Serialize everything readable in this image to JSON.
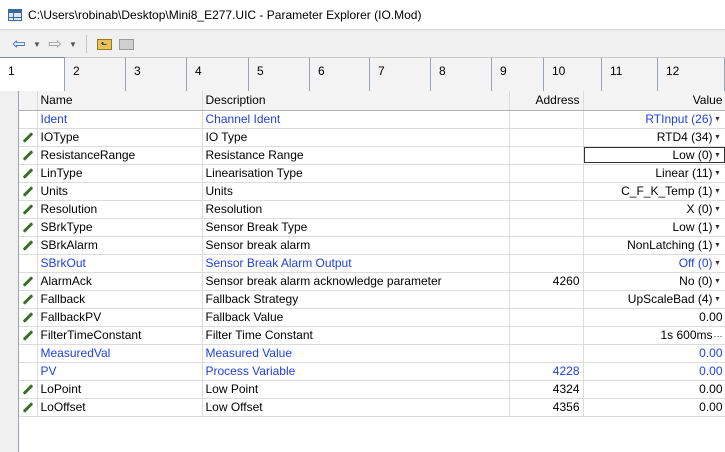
{
  "window": {
    "title": "C:\\Users\\robinab\\Desktop\\Mini8_E277.UIC - Parameter Explorer (IO.Mod)"
  },
  "toolbar": {
    "back_icon": "arrow-left-icon",
    "forward_icon": "arrow-right-icon"
  },
  "tabs": [
    "1",
    "2",
    "3",
    "4",
    "5",
    "6",
    "7",
    "8",
    "9",
    "10",
    "11",
    "12"
  ],
  "columns": {
    "name": "Name",
    "description": "Description",
    "address": "Address",
    "value": "Value"
  },
  "rows": [
    {
      "name": "Ident",
      "description": "Channel Ident",
      "address": "",
      "value": "RTInput (26)",
      "editable": false,
      "blue": true,
      "control": "dropdown"
    },
    {
      "name": "IOType",
      "description": "IO Type",
      "address": "",
      "value": "RTD4 (34)",
      "editable": true,
      "blue": false,
      "control": "dropdown"
    },
    {
      "name": "ResistanceRange",
      "description": "Resistance Range",
      "address": "",
      "value": "Low (0)",
      "editable": true,
      "blue": false,
      "control": "dropdown",
      "focused": true
    },
    {
      "name": "LinType",
      "description": "Linearisation Type",
      "address": "",
      "value": "Linear (11)",
      "editable": true,
      "blue": false,
      "control": "dropdown"
    },
    {
      "name": "Units",
      "description": "Units",
      "address": "",
      "value": "C_F_K_Temp (1)",
      "editable": true,
      "blue": false,
      "control": "dropdown"
    },
    {
      "name": "Resolution",
      "description": "Resolution",
      "address": "",
      "value": "X (0)",
      "editable": true,
      "blue": false,
      "control": "dropdown"
    },
    {
      "name": "SBrkType",
      "description": "Sensor Break Type",
      "address": "",
      "value": "Low (1)",
      "editable": true,
      "blue": false,
      "control": "dropdown"
    },
    {
      "name": "SBrkAlarm",
      "description": "Sensor break alarm",
      "address": "",
      "value": "NonLatching (1)",
      "editable": true,
      "blue": false,
      "control": "dropdown"
    },
    {
      "name": "SBrkOut",
      "description": "Sensor Break Alarm Output",
      "address": "",
      "value": "Off (0)",
      "editable": false,
      "blue": true,
      "control": "dropdown"
    },
    {
      "name": "AlarmAck",
      "description": "Sensor break alarm acknowledge parameter",
      "address": "4260",
      "value": "No (0)",
      "editable": true,
      "blue": false,
      "control": "dropdown"
    },
    {
      "name": "Fallback",
      "description": "Fallback Strategy",
      "address": "",
      "value": "UpScaleBad (4)",
      "editable": true,
      "blue": false,
      "control": "dropdown"
    },
    {
      "name": "FallbackPV",
      "description": "Fallback Value",
      "address": "",
      "value": "0.00",
      "editable": true,
      "blue": false,
      "control": "none"
    },
    {
      "name": "FilterTimeConstant",
      "description": "Filter Time Constant",
      "address": "",
      "value": "1s 600ms",
      "editable": true,
      "blue": false,
      "control": "ellipsis"
    },
    {
      "name": "MeasuredVal",
      "description": "Measured Value",
      "address": "",
      "value": "0.00",
      "editable": false,
      "blue": true,
      "control": "none"
    },
    {
      "name": "PV",
      "description": "Process Variable",
      "address": "4228",
      "value": "0.00",
      "editable": false,
      "blue": true,
      "control": "none"
    },
    {
      "name": "LoPoint",
      "description": "Low Point",
      "address": "4324",
      "value": "0.00",
      "editable": true,
      "blue": false,
      "control": "none"
    },
    {
      "name": "LoOffset",
      "description": "Low Offset",
      "address": "4356",
      "value": "0.00",
      "editable": true,
      "blue": false,
      "control": "none"
    }
  ]
}
